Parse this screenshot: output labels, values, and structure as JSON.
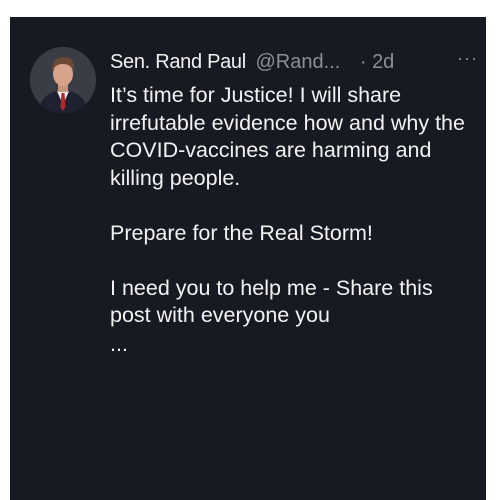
{
  "tweet": {
    "author_name": "Sen. Rand Paul",
    "handle": "@Rand...",
    "separator": "·",
    "time": "2d",
    "more_icon": "more-options-icon",
    "more_symbol": "···",
    "paragraphs": [
      "It’s time for Justice! I will share irrefutable evidence how and why the COVID-vaccines are harming and killing people.",
      "Prepare for the Real Storm!",
      "I need you to help me - Share this post with everyone you"
    ],
    "ellipsis": "..."
  },
  "colors": {
    "background": "#161a22",
    "text": "#f2f2f2",
    "muted": "#8b8f96",
    "page": "#ffffff"
  }
}
